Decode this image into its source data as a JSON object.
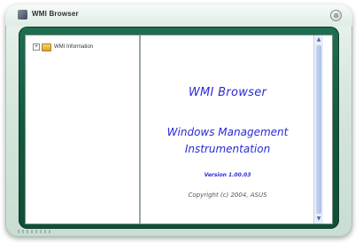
{
  "window": {
    "title": "WMI Browser",
    "close_glyph": "⊗",
    "app_icon": "wmi-app-icon"
  },
  "tree": {
    "items": [
      {
        "expander": "+",
        "icon": "folder-icon",
        "label": "WMI Information"
      }
    ]
  },
  "content": {
    "title": "WMI Browser",
    "subtitle_line1": "Windows Management",
    "subtitle_line2": "Instrumentation",
    "version": "Version 1.00.03",
    "copyright": "Copyright (c) 2004,  ASUS"
  },
  "colors": {
    "frame": "#12583f",
    "accent_text": "#2a2ad8"
  }
}
